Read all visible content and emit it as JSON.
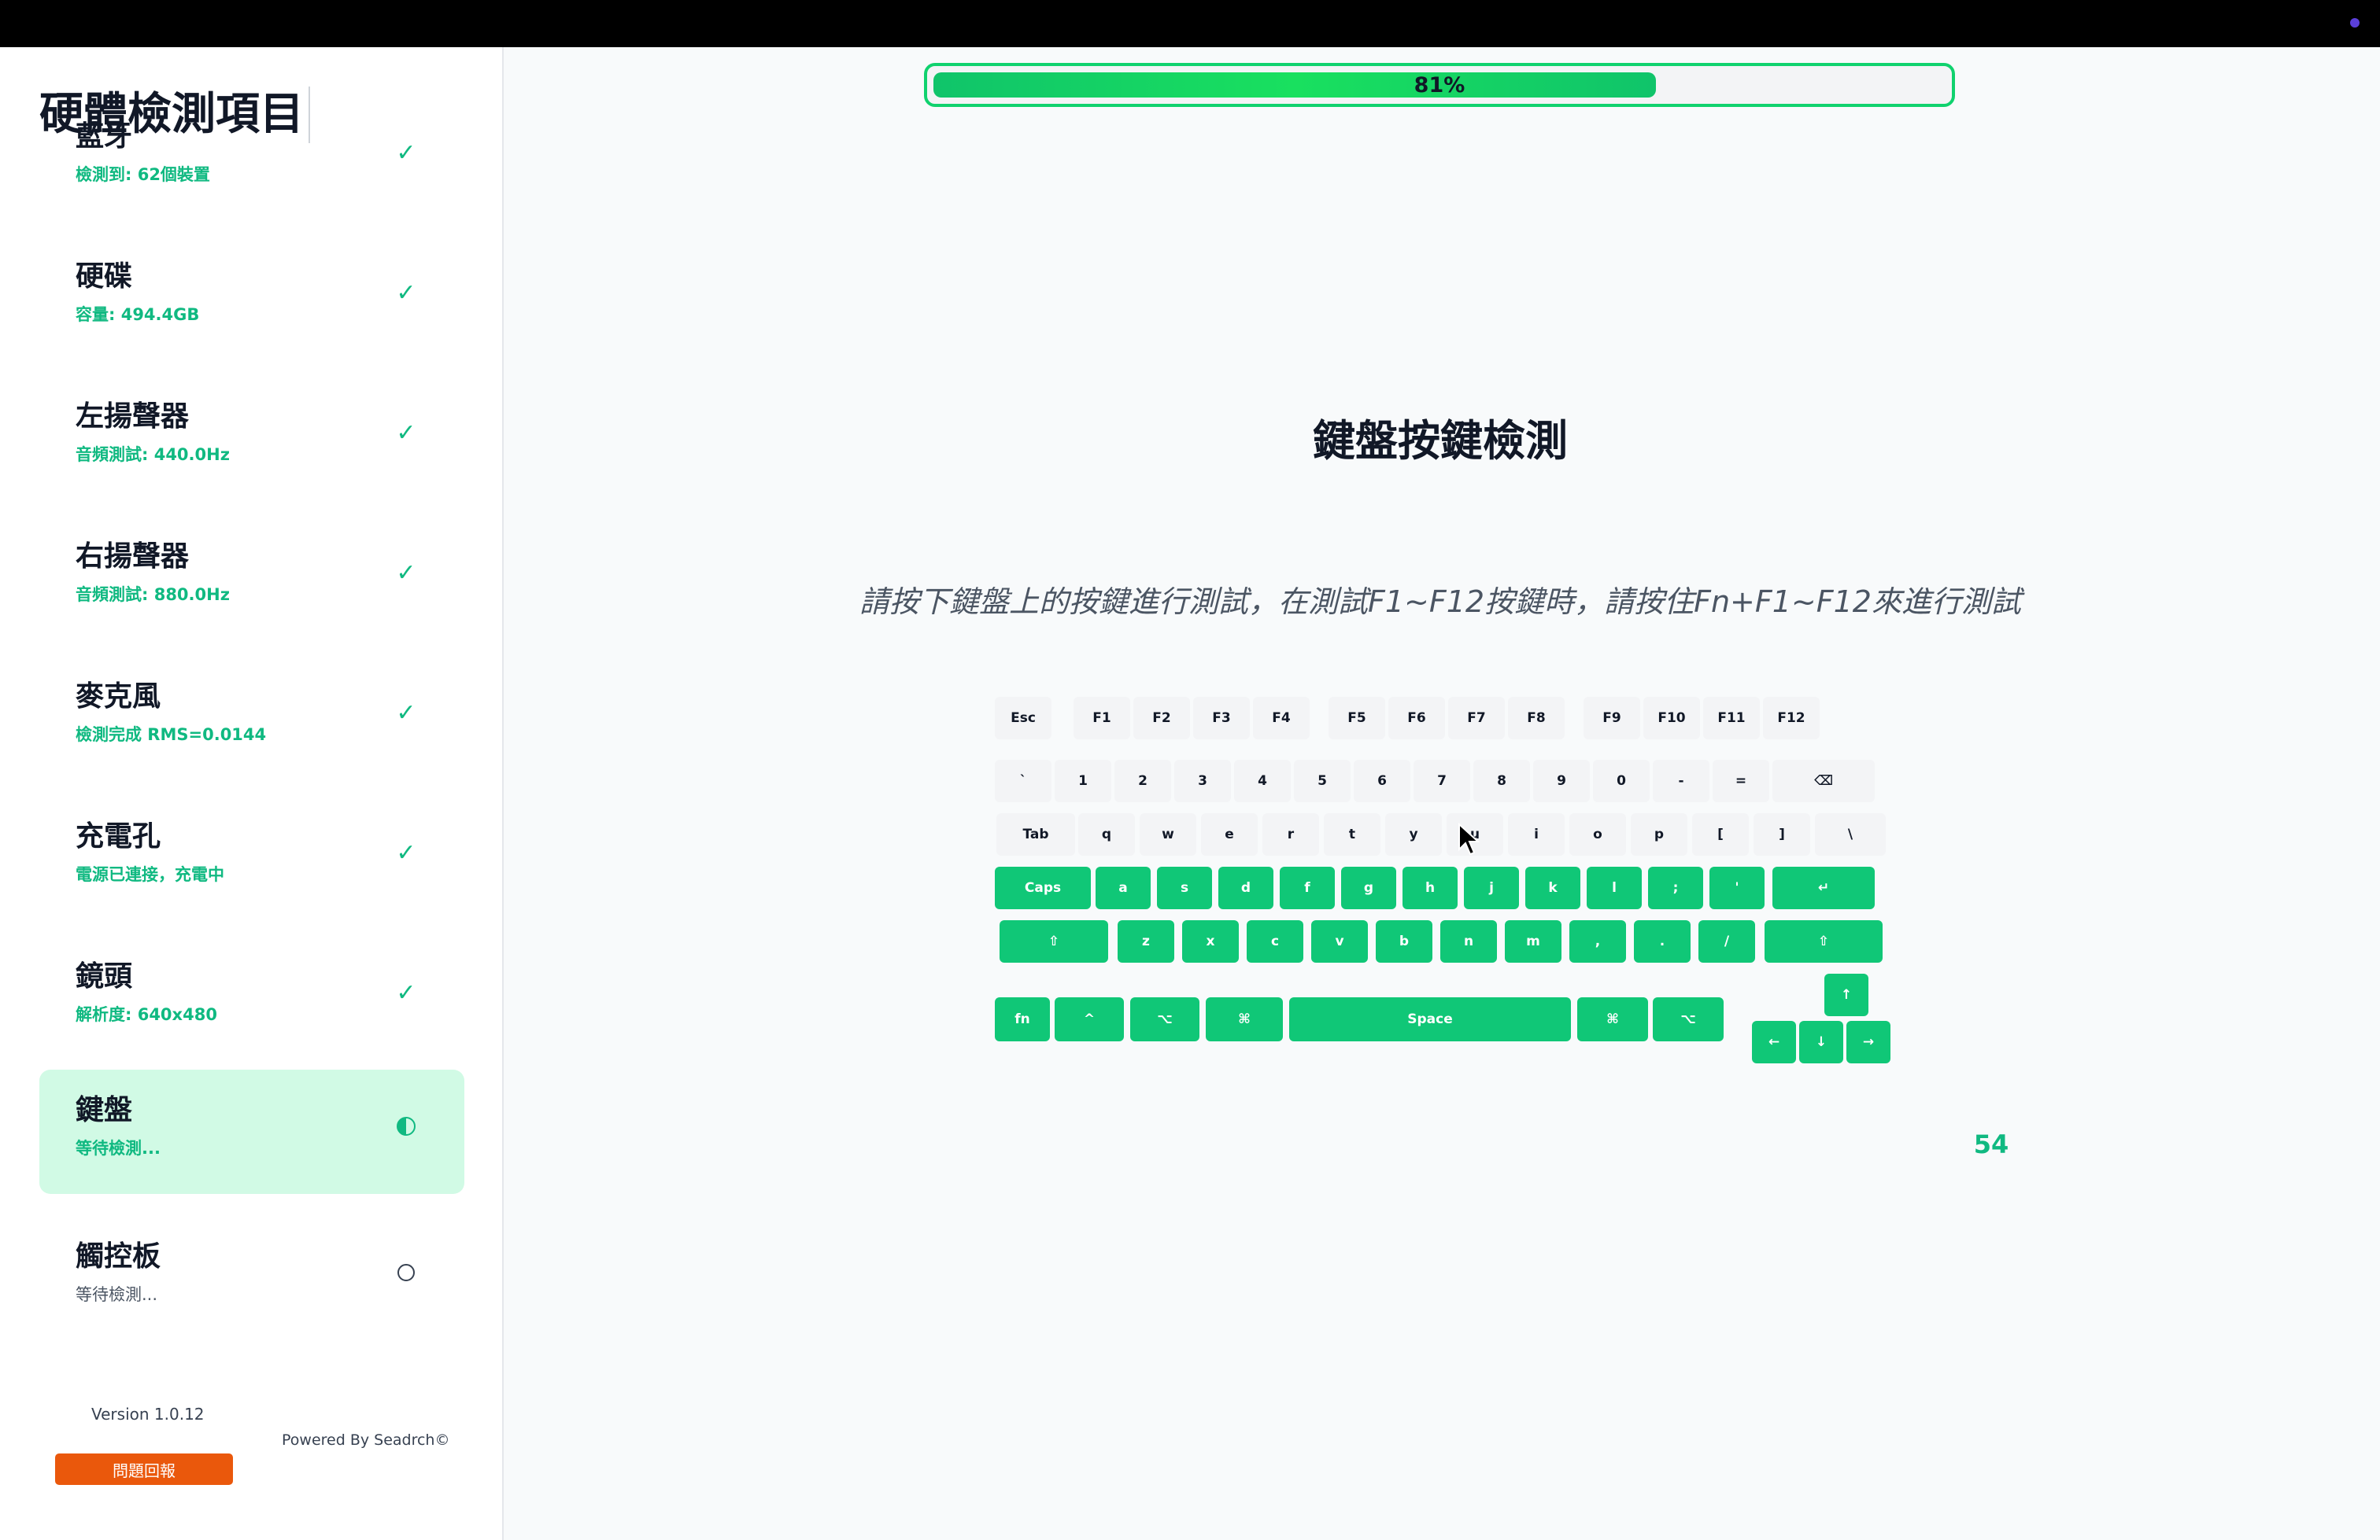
{
  "sidebar": {
    "title": "硬體檢測項目",
    "items": [
      {
        "name": "藍牙",
        "sub": "檢測到: 62個裝置",
        "status": "done"
      },
      {
        "name": "硬碟",
        "sub": "容量: 494.4GB",
        "status": "done"
      },
      {
        "name": "左揚聲器",
        "sub": "音頻測試: 440.0Hz",
        "status": "done"
      },
      {
        "name": "右揚聲器",
        "sub": "音頻測試: 880.0Hz",
        "status": "done"
      },
      {
        "name": "麥克風",
        "sub": "檢測完成 RMS=0.0144",
        "status": "done"
      },
      {
        "name": "充電孔",
        "sub": "電源已連接，充電中",
        "status": "done"
      },
      {
        "name": "鏡頭",
        "sub": "解析度: 640x480",
        "status": "done"
      },
      {
        "name": "鍵盤",
        "sub": "等待檢測...",
        "status": "in-progress"
      },
      {
        "name": "觸控板",
        "sub": "等待檢測...",
        "status": "pending"
      }
    ],
    "check_glyph": "✓",
    "version": "Version 1.0.12",
    "powered_by": "Powered By Seadrch©",
    "report_label": "問題回報"
  },
  "progress": {
    "percent": 81,
    "label": "81%"
  },
  "main": {
    "title": "鍵盤按鍵檢測",
    "instruction": "請按下鍵盤上的按鍵進行測試，在測試F1~F12按鍵時，請按住Fn+F1~F12來進行測試",
    "counter": "54"
  },
  "keyboard": {
    "rows": [
      [
        {
          "label": "Esc",
          "pressed": false
        },
        {
          "label": "F1",
          "pressed": false
        },
        {
          "label": "F2",
          "pressed": false
        },
        {
          "label": "F3",
          "pressed": false
        },
        {
          "label": "F4",
          "pressed": false
        },
        {
          "label": "F5",
          "pressed": false
        },
        {
          "label": "F6",
          "pressed": false
        },
        {
          "label": "F7",
          "pressed": false
        },
        {
          "label": "F8",
          "pressed": false
        },
        {
          "label": "F9",
          "pressed": false
        },
        {
          "label": "F10",
          "pressed": false
        },
        {
          "label": "F11",
          "pressed": false
        },
        {
          "label": "F12",
          "pressed": false
        }
      ],
      [
        {
          "label": "`",
          "pressed": false
        },
        {
          "label": "1",
          "pressed": false
        },
        {
          "label": "2",
          "pressed": false
        },
        {
          "label": "3",
          "pressed": false
        },
        {
          "label": "4",
          "pressed": false
        },
        {
          "label": "5",
          "pressed": false
        },
        {
          "label": "6",
          "pressed": false
        },
        {
          "label": "7",
          "pressed": false
        },
        {
          "label": "8",
          "pressed": false
        },
        {
          "label": "9",
          "pressed": false
        },
        {
          "label": "0",
          "pressed": false
        },
        {
          "label": "-",
          "pressed": false
        },
        {
          "label": "=",
          "pressed": false
        },
        {
          "label": "⌫",
          "pressed": false
        }
      ],
      [
        {
          "label": "Tab",
          "pressed": false
        },
        {
          "label": "q",
          "pressed": false
        },
        {
          "label": "w",
          "pressed": false
        },
        {
          "label": "e",
          "pressed": false
        },
        {
          "label": "r",
          "pressed": false
        },
        {
          "label": "t",
          "pressed": false
        },
        {
          "label": "y",
          "pressed": false
        },
        {
          "label": "u",
          "pressed": false
        },
        {
          "label": "i",
          "pressed": false
        },
        {
          "label": "o",
          "pressed": false
        },
        {
          "label": "p",
          "pressed": false
        },
        {
          "label": "[",
          "pressed": false
        },
        {
          "label": "]",
          "pressed": false
        },
        {
          "label": "\\",
          "pressed": false
        }
      ],
      [
        {
          "label": "Caps",
          "pressed": true
        },
        {
          "label": "a",
          "pressed": true
        },
        {
          "label": "s",
          "pressed": true
        },
        {
          "label": "d",
          "pressed": true
        },
        {
          "label": "f",
          "pressed": true
        },
        {
          "label": "g",
          "pressed": true
        },
        {
          "label": "h",
          "pressed": true
        },
        {
          "label": "j",
          "pressed": true
        },
        {
          "label": "k",
          "pressed": true
        },
        {
          "label": "l",
          "pressed": true
        },
        {
          "label": ";",
          "pressed": true
        },
        {
          "label": "'",
          "pressed": true
        },
        {
          "label": "↵",
          "pressed": true
        }
      ],
      [
        {
          "label": "⇧",
          "pressed": true
        },
        {
          "label": "z",
          "pressed": true
        },
        {
          "label": "x",
          "pressed": true
        },
        {
          "label": "c",
          "pressed": true
        },
        {
          "label": "v",
          "pressed": true
        },
        {
          "label": "b",
          "pressed": true
        },
        {
          "label": "n",
          "pressed": true
        },
        {
          "label": "m",
          "pressed": true
        },
        {
          "label": ",",
          "pressed": true
        },
        {
          "label": ".",
          "pressed": true
        },
        {
          "label": "/",
          "pressed": true
        },
        {
          "label": "⇧",
          "pressed": true
        }
      ],
      [
        {
          "label": "fn",
          "pressed": true
        },
        {
          "label": "^",
          "pressed": true
        },
        {
          "label": "⌥",
          "pressed": true
        },
        {
          "label": "⌘",
          "pressed": true
        },
        {
          "label": "Space",
          "pressed": true
        },
        {
          "label": "⌘",
          "pressed": true
        },
        {
          "label": "⌥",
          "pressed": true
        }
      ],
      [
        {
          "label": "↑",
          "pressed": true
        },
        {
          "label": "←",
          "pressed": true
        },
        {
          "label": "↓",
          "pressed": true
        },
        {
          "label": "→",
          "pressed": true
        }
      ]
    ]
  }
}
